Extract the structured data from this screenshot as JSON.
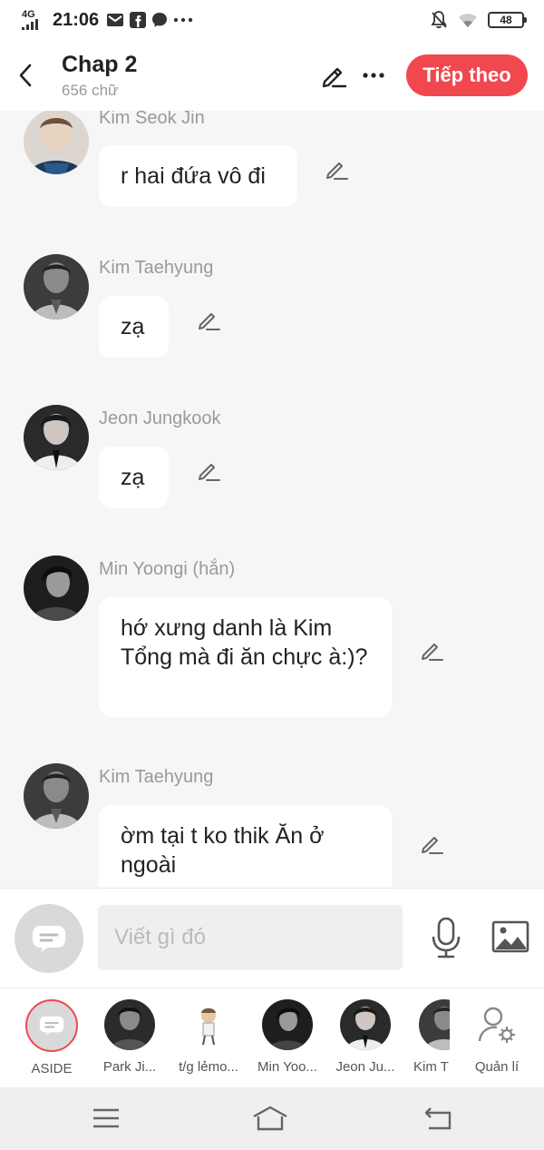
{
  "status_bar": {
    "network": "4G",
    "time": "21:06",
    "battery": "48",
    "icons": [
      "mail-icon",
      "facebook-icon",
      "messenger-icon",
      "more-dots-icon",
      "bell-off-icon",
      "wifi-icon",
      "battery-icon"
    ]
  },
  "header": {
    "title": "Chap 2",
    "subtitle": "656 chữ",
    "next_label": "Tiếp theo"
  },
  "messages": [
    {
      "sender": "Kim Seok Jin",
      "text": "r hai đứa vô đi"
    },
    {
      "sender": "Kim Taehyung",
      "text": "zạ"
    },
    {
      "sender": "Jeon Jungkook",
      "text": "zạ"
    },
    {
      "sender": "Min Yoongi (hắn)",
      "text": "hớ xưng danh là Kim Tổng mà đi ăn chực à:)?"
    },
    {
      "sender": "Kim Taehyung",
      "text": "ờm tại t ko thik Ăn ở ngoài"
    }
  ],
  "input": {
    "placeholder": "Viết gì đó"
  },
  "characters": [
    {
      "name": "ASIDE"
    },
    {
      "name": "Park Ji..."
    },
    {
      "name": "t/g lẻmo..."
    },
    {
      "name": "Min Yoo..."
    },
    {
      "name": "Jeon Ju..."
    },
    {
      "name": "Kim T"
    },
    {
      "name": "Quản lí"
    }
  ],
  "colors": {
    "accent": "#f0484e",
    "background": "#f6f6f6",
    "bubble": "#ffffff",
    "sender_text": "#9a9a9a"
  }
}
